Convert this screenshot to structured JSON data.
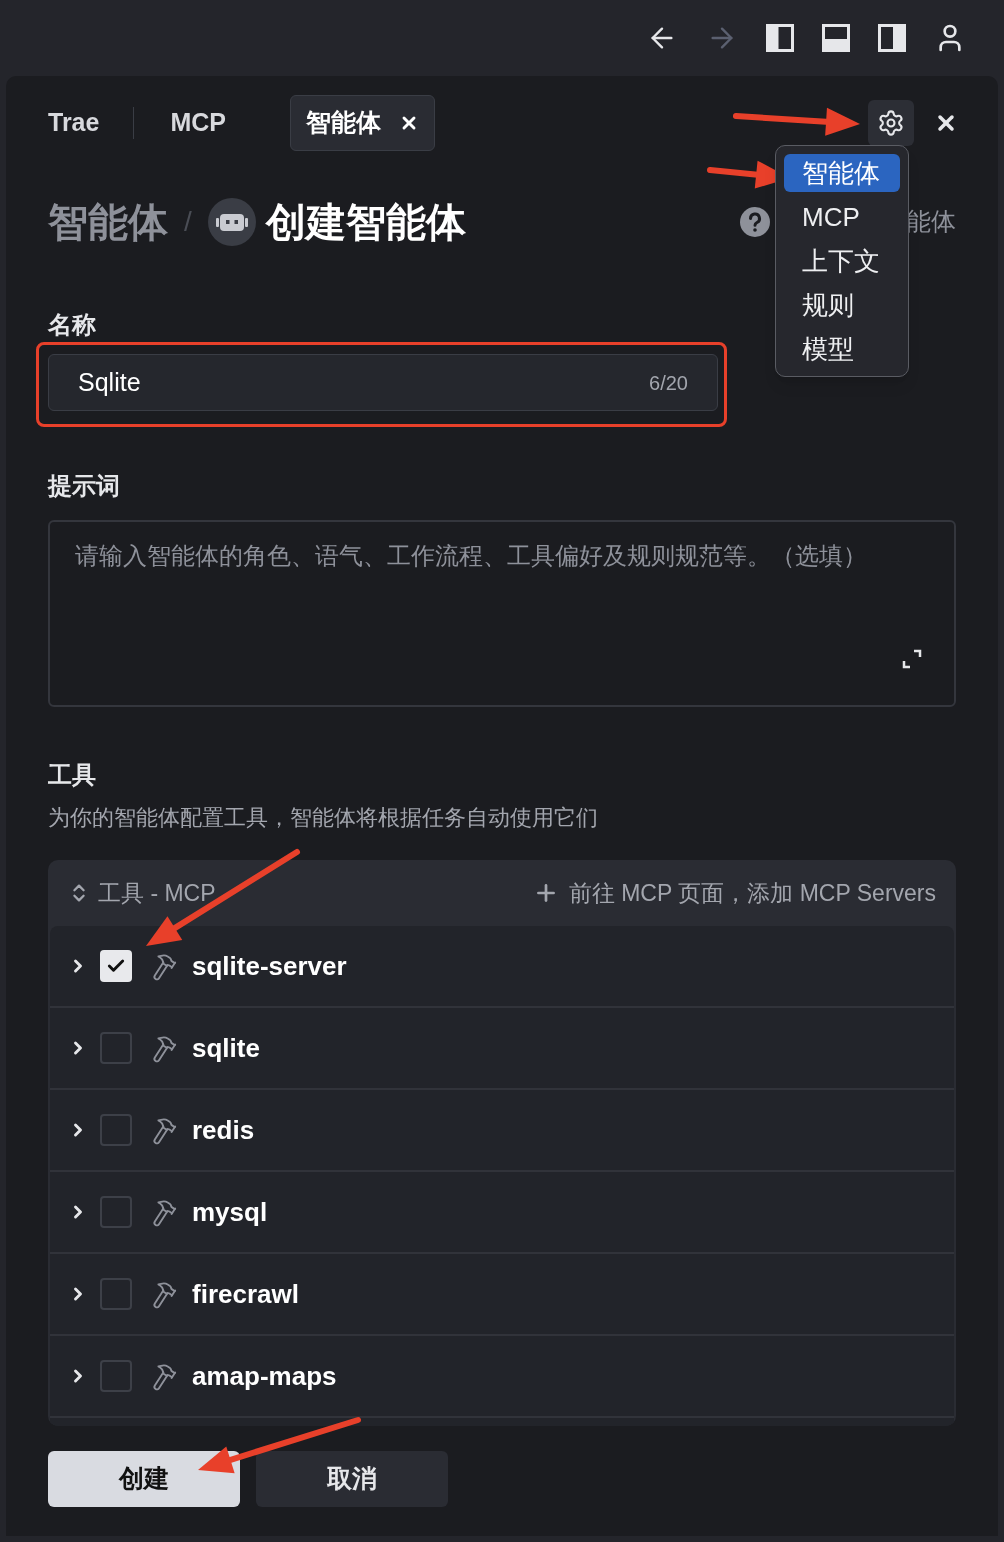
{
  "toolbar": {
    "buttons": [
      {
        "kind": "back",
        "disabled": false
      },
      {
        "kind": "forward",
        "disabled": true
      },
      {
        "kind": "panel-left",
        "disabled": false
      },
      {
        "kind": "panel-bottom",
        "disabled": false
      },
      {
        "kind": "panel-right",
        "disabled": false
      },
      {
        "kind": "account",
        "disabled": false
      }
    ]
  },
  "tabs": [
    {
      "label": "Trae",
      "selected": false,
      "closable": false
    },
    {
      "label": "MCP",
      "selected": false,
      "closable": false
    },
    {
      "label": "智能体",
      "selected": true,
      "closable": true
    }
  ],
  "breadcrumb": {
    "parent": "智能体",
    "separator": "/",
    "current": "创建智能体"
  },
  "help_link": {
    "visible_text": "能体"
  },
  "menu": {
    "items": [
      {
        "label": "智能体",
        "selected": true
      },
      {
        "label": "MCP",
        "selected": false
      },
      {
        "label": "上下文",
        "selected": false
      },
      {
        "label": "规则",
        "selected": false
      },
      {
        "label": "模型",
        "selected": false
      }
    ]
  },
  "name_field": {
    "label": "名称",
    "value": "Sqlite",
    "counter": "6/20"
  },
  "prompt_field": {
    "label": "提示词",
    "placeholder": "请输入智能体的角色、语气、工作流程、工具偏好及规则规范等。（选填）"
  },
  "tools": {
    "title": "工具",
    "description": "为你的智能体配置工具，智能体将根据任务自动使用它们",
    "group_label": "工具 - MCP",
    "add_link": "前往 MCP 页面，添加 MCP Servers",
    "items": [
      {
        "name": "sqlite-server",
        "checked": true,
        "expanded": false
      },
      {
        "name": "sqlite",
        "checked": false,
        "expanded": false
      },
      {
        "name": "redis",
        "checked": false,
        "expanded": false
      },
      {
        "name": "mysql",
        "checked": false,
        "expanded": false
      },
      {
        "name": "firecrawl",
        "checked": false,
        "expanded": false
      },
      {
        "name": "amap-maps",
        "checked": false,
        "expanded": false
      }
    ]
  },
  "buttons": [
    {
      "label": "创建",
      "kind": "primary"
    },
    {
      "label": "取消",
      "kind": "secondary"
    }
  ]
}
